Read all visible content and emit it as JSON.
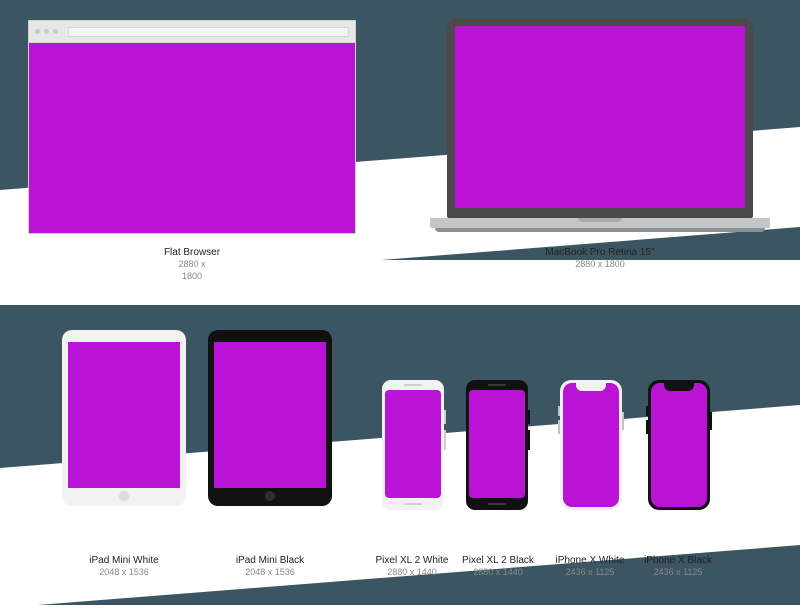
{
  "screen_color": "#bb13d6",
  "devices": {
    "browser": {
      "name": "Flat Browser",
      "dims": "2880 x\n1800"
    },
    "macbook": {
      "name": "MacBook Pro Retina 15\"",
      "dims": "2880 x 1800"
    },
    "ipad_w": {
      "name": "iPad Mini White",
      "dims": "2048 x 1536"
    },
    "ipad_b": {
      "name": "iPad Mini Black",
      "dims": "2048 x 1536"
    },
    "pixel_w": {
      "name": "Pixel XL 2 White",
      "dims": "2880 x 1440"
    },
    "pixel_b": {
      "name": "Pixel XL 2 Black",
      "dims": "2880 x 1440"
    },
    "iphx_w": {
      "name": "iPhone X White",
      "dims": "2436 x 1125"
    },
    "iphx_b": {
      "name": "iPhone X Black",
      "dims": "2436 x 1125"
    }
  }
}
